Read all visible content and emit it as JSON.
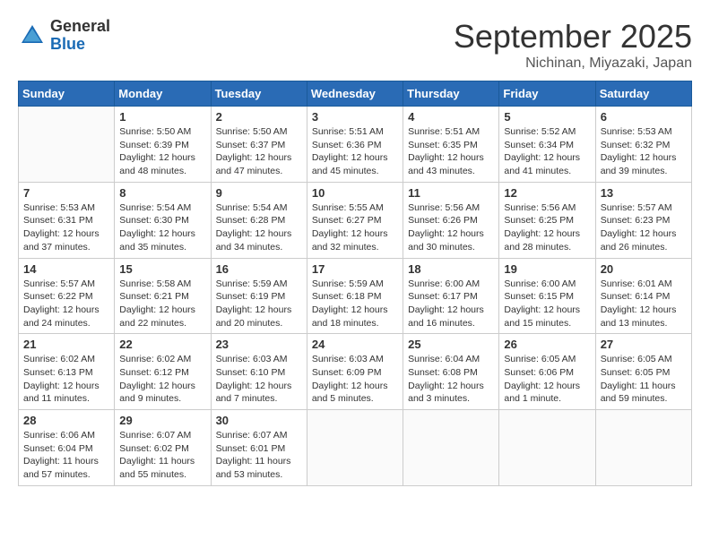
{
  "logo": {
    "general": "General",
    "blue": "Blue"
  },
  "title": "September 2025",
  "location": "Nichinan, Miyazaki, Japan",
  "days_of_week": [
    "Sunday",
    "Monday",
    "Tuesday",
    "Wednesday",
    "Thursday",
    "Friday",
    "Saturday"
  ],
  "weeks": [
    [
      {
        "day": "",
        "info": ""
      },
      {
        "day": "1",
        "info": "Sunrise: 5:50 AM\nSunset: 6:39 PM\nDaylight: 12 hours\nand 48 minutes."
      },
      {
        "day": "2",
        "info": "Sunrise: 5:50 AM\nSunset: 6:37 PM\nDaylight: 12 hours\nand 47 minutes."
      },
      {
        "day": "3",
        "info": "Sunrise: 5:51 AM\nSunset: 6:36 PM\nDaylight: 12 hours\nand 45 minutes."
      },
      {
        "day": "4",
        "info": "Sunrise: 5:51 AM\nSunset: 6:35 PM\nDaylight: 12 hours\nand 43 minutes."
      },
      {
        "day": "5",
        "info": "Sunrise: 5:52 AM\nSunset: 6:34 PM\nDaylight: 12 hours\nand 41 minutes."
      },
      {
        "day": "6",
        "info": "Sunrise: 5:53 AM\nSunset: 6:32 PM\nDaylight: 12 hours\nand 39 minutes."
      }
    ],
    [
      {
        "day": "7",
        "info": "Sunrise: 5:53 AM\nSunset: 6:31 PM\nDaylight: 12 hours\nand 37 minutes."
      },
      {
        "day": "8",
        "info": "Sunrise: 5:54 AM\nSunset: 6:30 PM\nDaylight: 12 hours\nand 35 minutes."
      },
      {
        "day": "9",
        "info": "Sunrise: 5:54 AM\nSunset: 6:28 PM\nDaylight: 12 hours\nand 34 minutes."
      },
      {
        "day": "10",
        "info": "Sunrise: 5:55 AM\nSunset: 6:27 PM\nDaylight: 12 hours\nand 32 minutes."
      },
      {
        "day": "11",
        "info": "Sunrise: 5:56 AM\nSunset: 6:26 PM\nDaylight: 12 hours\nand 30 minutes."
      },
      {
        "day": "12",
        "info": "Sunrise: 5:56 AM\nSunset: 6:25 PM\nDaylight: 12 hours\nand 28 minutes."
      },
      {
        "day": "13",
        "info": "Sunrise: 5:57 AM\nSunset: 6:23 PM\nDaylight: 12 hours\nand 26 minutes."
      }
    ],
    [
      {
        "day": "14",
        "info": "Sunrise: 5:57 AM\nSunset: 6:22 PM\nDaylight: 12 hours\nand 24 minutes."
      },
      {
        "day": "15",
        "info": "Sunrise: 5:58 AM\nSunset: 6:21 PM\nDaylight: 12 hours\nand 22 minutes."
      },
      {
        "day": "16",
        "info": "Sunrise: 5:59 AM\nSunset: 6:19 PM\nDaylight: 12 hours\nand 20 minutes."
      },
      {
        "day": "17",
        "info": "Sunrise: 5:59 AM\nSunset: 6:18 PM\nDaylight: 12 hours\nand 18 minutes."
      },
      {
        "day": "18",
        "info": "Sunrise: 6:00 AM\nSunset: 6:17 PM\nDaylight: 12 hours\nand 16 minutes."
      },
      {
        "day": "19",
        "info": "Sunrise: 6:00 AM\nSunset: 6:15 PM\nDaylight: 12 hours\nand 15 minutes."
      },
      {
        "day": "20",
        "info": "Sunrise: 6:01 AM\nSunset: 6:14 PM\nDaylight: 12 hours\nand 13 minutes."
      }
    ],
    [
      {
        "day": "21",
        "info": "Sunrise: 6:02 AM\nSunset: 6:13 PM\nDaylight: 12 hours\nand 11 minutes."
      },
      {
        "day": "22",
        "info": "Sunrise: 6:02 AM\nSunset: 6:12 PM\nDaylight: 12 hours\nand 9 minutes."
      },
      {
        "day": "23",
        "info": "Sunrise: 6:03 AM\nSunset: 6:10 PM\nDaylight: 12 hours\nand 7 minutes."
      },
      {
        "day": "24",
        "info": "Sunrise: 6:03 AM\nSunset: 6:09 PM\nDaylight: 12 hours\nand 5 minutes."
      },
      {
        "day": "25",
        "info": "Sunrise: 6:04 AM\nSunset: 6:08 PM\nDaylight: 12 hours\nand 3 minutes."
      },
      {
        "day": "26",
        "info": "Sunrise: 6:05 AM\nSunset: 6:06 PM\nDaylight: 12 hours\nand 1 minute."
      },
      {
        "day": "27",
        "info": "Sunrise: 6:05 AM\nSunset: 6:05 PM\nDaylight: 11 hours\nand 59 minutes."
      }
    ],
    [
      {
        "day": "28",
        "info": "Sunrise: 6:06 AM\nSunset: 6:04 PM\nDaylight: 11 hours\nand 57 minutes."
      },
      {
        "day": "29",
        "info": "Sunrise: 6:07 AM\nSunset: 6:02 PM\nDaylight: 11 hours\nand 55 minutes."
      },
      {
        "day": "30",
        "info": "Sunrise: 6:07 AM\nSunset: 6:01 PM\nDaylight: 11 hours\nand 53 minutes."
      },
      {
        "day": "",
        "info": ""
      },
      {
        "day": "",
        "info": ""
      },
      {
        "day": "",
        "info": ""
      },
      {
        "day": "",
        "info": ""
      }
    ]
  ]
}
